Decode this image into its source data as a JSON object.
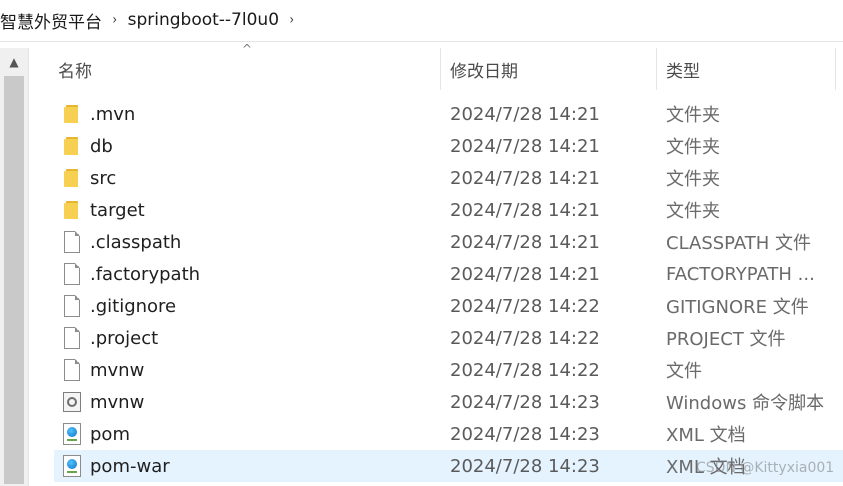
{
  "breadcrumb": {
    "items": [
      "智慧外贸平台",
      "springboot--7l0u0"
    ],
    "separator": "›"
  },
  "header": {
    "sort_indicator": "^",
    "columns": [
      "名称",
      "修改日期",
      "类型"
    ]
  },
  "files": [
    {
      "name": ".mvn",
      "date": "2024/7/28 14:21",
      "type": "文件夹",
      "icon": "folder-icon"
    },
    {
      "name": "db",
      "date": "2024/7/28 14:21",
      "type": "文件夹",
      "icon": "folder-icon"
    },
    {
      "name": "src",
      "date": "2024/7/28 14:21",
      "type": "文件夹",
      "icon": "folder-icon"
    },
    {
      "name": "target",
      "date": "2024/7/28 14:21",
      "type": "文件夹",
      "icon": "folder-icon"
    },
    {
      "name": ".classpath",
      "date": "2024/7/28 14:21",
      "type": "CLASSPATH 文件",
      "icon": "file-icon"
    },
    {
      "name": ".factorypath",
      "date": "2024/7/28 14:21",
      "type": "FACTORYPATH ...",
      "icon": "file-icon"
    },
    {
      "name": ".gitignore",
      "date": "2024/7/28 14:22",
      "type": "GITIGNORE 文件",
      "icon": "file-icon"
    },
    {
      "name": ".project",
      "date": "2024/7/28 14:22",
      "type": "PROJECT 文件",
      "icon": "file-icon"
    },
    {
      "name": "mvnw",
      "date": "2024/7/28 14:22",
      "type": "文件",
      "icon": "file-icon"
    },
    {
      "name": "mvnw",
      "date": "2024/7/28 14:23",
      "type": "Windows 命令脚本",
      "icon": "script-icon"
    },
    {
      "name": "pom",
      "date": "2024/7/28 14:23",
      "type": "XML 文档",
      "icon": "xml-icon"
    },
    {
      "name": "pom-war",
      "date": "2024/7/28 14:23",
      "type": "XML 文档",
      "icon": "xml-icon",
      "selected": true
    }
  ],
  "scrollbar": {
    "up_arrow": "▲"
  },
  "watermark": "CSDN @Kittyxia001",
  "colors": {
    "folder": "#f7cf52",
    "selected_row": "#e5f3ff",
    "header_text": "#4b4b4b"
  }
}
